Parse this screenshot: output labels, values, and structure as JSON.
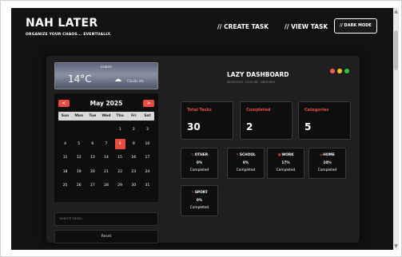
{
  "header": {
    "brand": "NAH LATER",
    "tagline": "ORGANIZE YOUR CHAOS... EVENTUALLY.",
    "nav_create": "// CREATE TASK",
    "nav_view": "// VIEW TASK",
    "dark_mode": "// DARK MODE"
  },
  "weather": {
    "city": "Lisbon",
    "temp": "14°C",
    "icon": "cloud-icon",
    "description": "Clouds etc"
  },
  "calendar": {
    "title": "May 2025",
    "prev": "<",
    "next": ">",
    "weekdays": [
      "Sun",
      "Mon",
      "Tue",
      "Wed",
      "Thu",
      "Fri",
      "Sat"
    ],
    "weeks": [
      [
        "",
        "",
        "",
        "",
        "1",
        "2",
        "3"
      ],
      [
        "4",
        "5",
        "6",
        "7",
        "8",
        "9",
        "10"
      ],
      [
        "11",
        "12",
        "13",
        "14",
        "15",
        "16",
        "17"
      ],
      [
        "18",
        "19",
        "20",
        "21",
        "22",
        "23",
        "24"
      ],
      [
        "25",
        "26",
        "27",
        "28",
        "29",
        "30",
        "31"
      ]
    ],
    "today": "8"
  },
  "search": {
    "placeholder": "Search tasks..."
  },
  "reset_label": "Reset",
  "dashboard": {
    "title": "LAZY DASHBOARD",
    "subtitle": "08/05/2025, 19:45:08 - SWITCHER",
    "window_dots": {
      "red": "#ff5f57",
      "yellow": "#febc2e",
      "green": "#28c840"
    },
    "accent": "#e74c3c",
    "stats": [
      {
        "label": "Total Tasks",
        "value": "30"
      },
      {
        "label": "Completed",
        "value": "2"
      },
      {
        "label": "Categories",
        "value": "5"
      }
    ],
    "categories": [
      {
        "icon": "pencil-icon",
        "glyph": "✎",
        "name": "OTHER",
        "pct": "0%",
        "status": "Completed"
      },
      {
        "icon": "school-icon",
        "glyph": "✎",
        "name": "SCHOOL",
        "pct": "0%",
        "status": "Completed"
      },
      {
        "icon": "briefcase-icon",
        "glyph": "▣",
        "name": "WORK",
        "pct": "17%",
        "status": "Completed"
      },
      {
        "icon": "home-icon",
        "glyph": "⌂",
        "name": "HOME",
        "pct": "10%",
        "status": "Completed"
      },
      {
        "icon": "sport-icon",
        "glyph": "✎",
        "name": "SPORT",
        "pct": "0%",
        "status": "Completed"
      }
    ]
  }
}
